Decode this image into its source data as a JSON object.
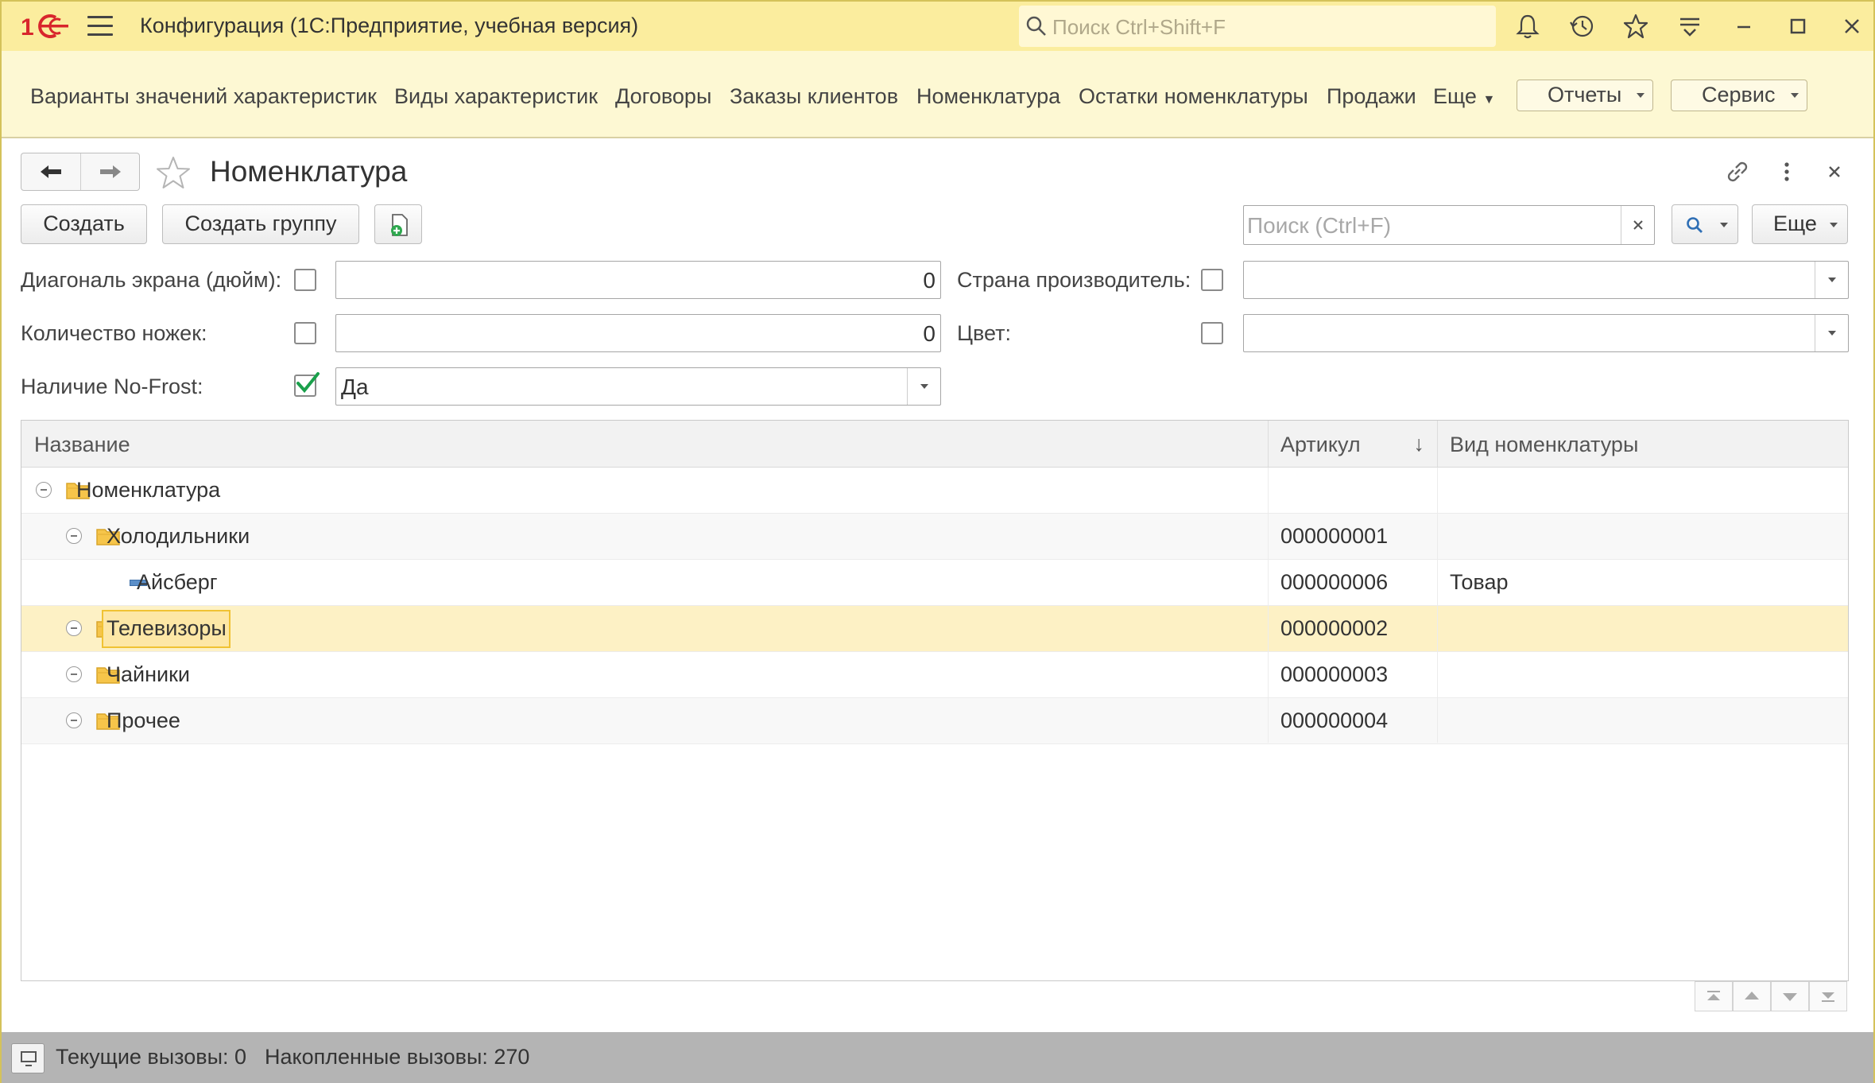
{
  "app": {
    "title": "Конфигурация  (1С:Предприятие, учебная версия)",
    "search_placeholder": "Поиск Ctrl+Shift+F",
    "logo": "1С"
  },
  "sections": {
    "items": [
      "Варианты значений характеристик",
      "Виды характеристик",
      "Договоры",
      "Заказы клиентов",
      "Номенклатура",
      "Остатки номенклатуры",
      "Продажи"
    ],
    "more": "Еще",
    "reports": "Отчеты",
    "service": "Сервис"
  },
  "form": {
    "title": "Номенклатура",
    "create": "Создать",
    "create_group": "Создать группу",
    "search_placeholder": "Поиск (Ctrl+F)",
    "more": "Еще",
    "filters": {
      "diagonal_label": "Диагональ экрана (дюйм):",
      "diagonal_value": "0",
      "legs_label": "Количество ножек:",
      "legs_value": "0",
      "nofrost_label": "Наличие No-Frost:",
      "nofrost_value": "Да",
      "country_label": "Страна производитель:",
      "country_value": "",
      "color_label": "Цвет:",
      "color_value": ""
    }
  },
  "table": {
    "columns": [
      "Название",
      "Артикул",
      "Вид номенклатуры"
    ],
    "sort_indicator": "↓",
    "rows": [
      {
        "name": "Номенклатура",
        "article": "",
        "kind": "",
        "level": 0,
        "type": "folder"
      },
      {
        "name": "Холодильники",
        "article": "000000001",
        "kind": "",
        "level": 1,
        "type": "folder"
      },
      {
        "name": "Айсберг",
        "article": "000000006",
        "kind": "Товар",
        "level": 2,
        "type": "item"
      },
      {
        "name": "Телевизоры",
        "article": "000000002",
        "kind": "",
        "level": 1,
        "type": "folder",
        "selected": true
      },
      {
        "name": "Чайники",
        "article": "000000003",
        "kind": "",
        "level": 1,
        "type": "folder"
      },
      {
        "name": "Прочее",
        "article": "000000004",
        "kind": "",
        "level": 1,
        "type": "folder"
      }
    ]
  },
  "status": {
    "current_calls": "Текущие вызовы: 0",
    "accumulated_calls": "Накопленные вызовы: 270"
  },
  "colors": {
    "titlebar": "#fbed9e",
    "sections": "#fdf8d3",
    "selection": "#fdf1c5",
    "accent_red": "#d8262c",
    "check_green": "#1aa04b"
  }
}
